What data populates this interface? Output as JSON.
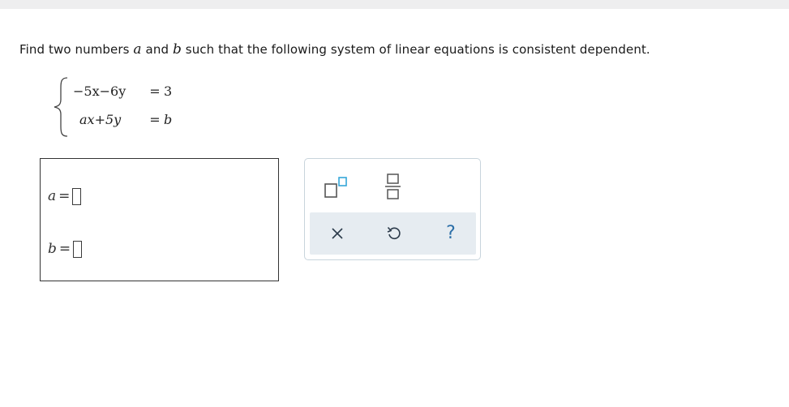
{
  "question": {
    "text_before_a": "Find two numbers ",
    "var_a": "a",
    "text_and": " and ",
    "var_b": "b",
    "text_after_b": " such that the following system of linear equations is consistent dependent."
  },
  "system": {
    "equations": [
      {
        "lhs": "−5x−6y",
        "op": "=",
        "rhs": "3"
      },
      {
        "lhs": "ax+5y",
        "op": "=",
        "rhs": "b"
      }
    ]
  },
  "answers": [
    {
      "var": "a",
      "eq": "=",
      "value": ""
    },
    {
      "var": "b",
      "eq": "=",
      "value": ""
    }
  ],
  "toolbar": {
    "tools": [
      "superscript-icon",
      "fraction-icon"
    ],
    "actions": [
      "clear-icon",
      "undo-icon",
      "help-icon"
    ],
    "help_label": "?",
    "colors": {
      "icon_blue": "#2c6fa8",
      "icon_gray": "#555555",
      "accent_light": "#35a6d8",
      "actionbar_bg": "#e6ecf1",
      "panel_border": "#c8d4dc"
    }
  }
}
